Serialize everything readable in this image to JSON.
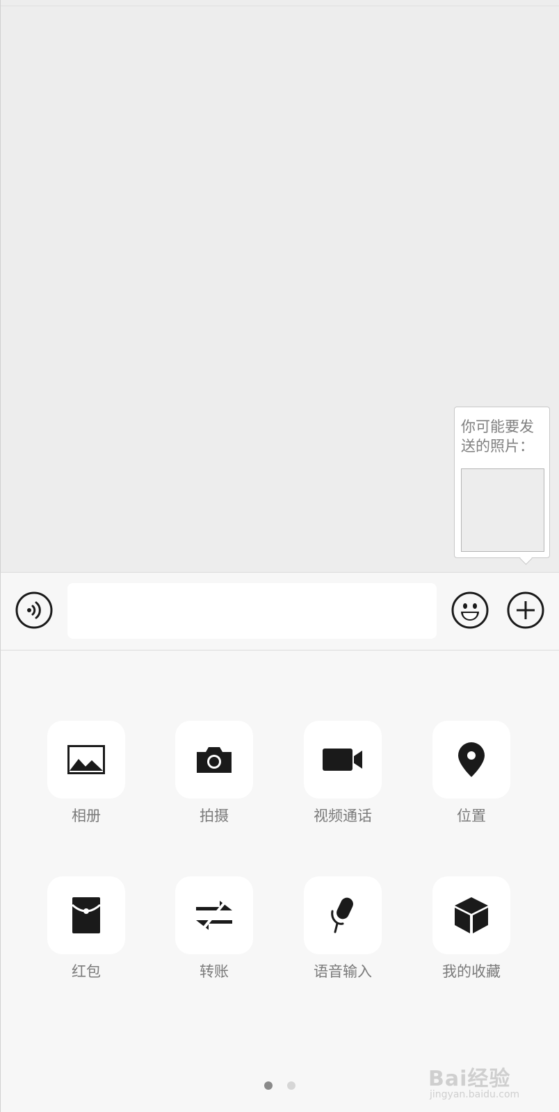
{
  "suggestion": {
    "text": "你可能要发送的照片："
  },
  "input": {
    "value": "",
    "placeholder": ""
  },
  "icons": {
    "voice": "voice-icon",
    "emoji": "emoji-icon",
    "more": "plus-icon"
  },
  "panel": {
    "items": [
      {
        "label": "相册",
        "icon": "photo-album-icon"
      },
      {
        "label": "拍摄",
        "icon": "camera-icon"
      },
      {
        "label": "视频通话",
        "icon": "video-call-icon"
      },
      {
        "label": "位置",
        "icon": "location-pin-icon"
      },
      {
        "label": "红包",
        "icon": "red-packet-icon"
      },
      {
        "label": "转账",
        "icon": "transfer-icon"
      },
      {
        "label": "语音输入",
        "icon": "microphone-icon"
      },
      {
        "label": "我的收藏",
        "icon": "favorites-box-icon"
      }
    ],
    "page_count": 2,
    "current_page": 1
  },
  "watermark": {
    "main": "Bai经验",
    "sub": "jingyan.baidu.com"
  },
  "colors": {
    "chat_bg": "#ededed",
    "panel_bg": "#f7f7f7",
    "icon": "#1a1a1a",
    "label": "#7a7a7a",
    "dot_active": "#8a8a8a",
    "dot_inactive": "#d6d6d6"
  }
}
